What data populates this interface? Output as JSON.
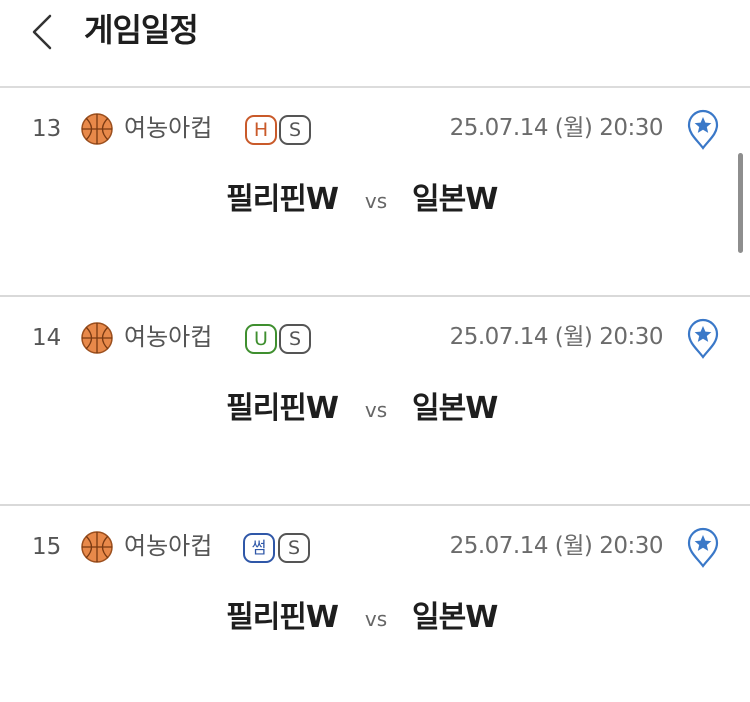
{
  "header": {
    "title": "게임일정",
    "back_icon": "chevron-left-icon"
  },
  "games": [
    {
      "number": "13",
      "sport_icon": "basketball-icon",
      "league": "여농아컵",
      "category_badge": "H",
      "category_color": "#c95a2a",
      "type_badge": "S",
      "datetime": "25.07.14 (월) 20:30",
      "pin_icon": "map-pin-star-icon",
      "home_team": "필리핀W",
      "vs_label": "vs",
      "away_team": "일본W"
    },
    {
      "number": "14",
      "sport_icon": "basketball-icon",
      "league": "여농아컵",
      "category_badge": "U",
      "category_color": "#3f8f2f",
      "type_badge": "S",
      "datetime": "25.07.14 (월) 20:30",
      "pin_icon": "map-pin-star-icon",
      "home_team": "필리핀W",
      "vs_label": "vs",
      "away_team": "일본W"
    },
    {
      "number": "15",
      "sport_icon": "basketball-icon",
      "league": "여농아컵",
      "category_badge": "썸",
      "category_color": "#2f57a8",
      "type_badge": "S",
      "datetime": "25.07.14 (월) 20:30",
      "pin_icon": "map-pin-star-icon",
      "home_team": "필리핀W",
      "vs_label": "vs",
      "away_team": "일본W"
    }
  ],
  "colors": {
    "pin": "#3a78c8",
    "ball": "#e8894a",
    "divider": "#d9d9d9"
  }
}
